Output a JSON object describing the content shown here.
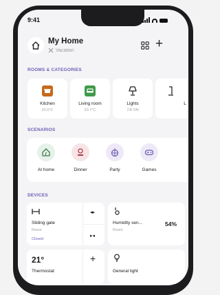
{
  "status": {
    "time": "9:41"
  },
  "header": {
    "title": "My Home",
    "subtitle": "Vacation"
  },
  "sections": {
    "rooms": "ROOMS & CATEGORIES",
    "scenarios": "SCENARIOS",
    "devices": "DEVICES"
  },
  "rooms": [
    {
      "name": "Kitchen",
      "sub": "20.5°C",
      "icon": "pot-icon",
      "color": "#c56a1c"
    },
    {
      "name": "Living room",
      "sub": "20.7°C",
      "icon": "sofa-icon",
      "color": "#3f9a4a"
    },
    {
      "name": "Lights",
      "sub": "7/8 ON",
      "icon": "lamp-icon",
      "color": "#ffffff"
    },
    {
      "name": "L",
      "sub": "",
      "icon": "lamp-icon",
      "color": "#ffffff"
    }
  ],
  "scenarios": [
    {
      "name": "At home",
      "icon": "home-leaf-icon",
      "color": "#e6f1ea"
    },
    {
      "name": "Dinner",
      "icon": "dinner-icon",
      "color": "#f6e4e6"
    },
    {
      "name": "Party",
      "icon": "disco-ball-icon",
      "color": "#efe9f7"
    },
    {
      "name": "Games",
      "icon": "gamepad-icon",
      "color": "#efe9f7"
    }
  ],
  "devices": {
    "gate": {
      "name": "Sliding gate",
      "room": "Room",
      "state": "Closed"
    },
    "humidity": {
      "name": "Humidity sen...",
      "room": "Room",
      "value": "54%"
    },
    "thermostat": {
      "value": "21°",
      "name": "Thermostat"
    },
    "light": {
      "name": "General light"
    }
  },
  "colors": {
    "accent": "#6a5fb5",
    "background": "#f4f4f6"
  }
}
